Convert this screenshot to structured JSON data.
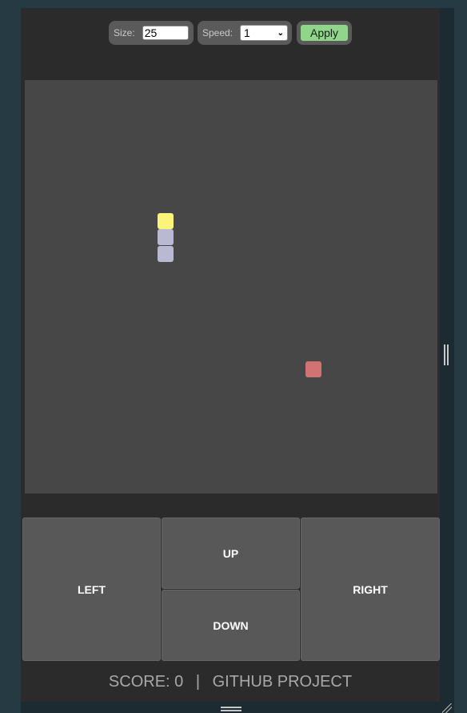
{
  "settings": {
    "size_label": "Size:",
    "size_value": "25",
    "speed_label": "Speed:",
    "speed_value": "1",
    "apply_label": "Apply",
    "apply_color": "#8fd68a"
  },
  "board": {
    "grid_size": 25,
    "background": "#474747",
    "snake": [
      {
        "col": 8,
        "row": 8,
        "part": "head"
      },
      {
        "col": 8,
        "row": 9,
        "part": "body"
      },
      {
        "col": 8,
        "row": 10,
        "part": "body"
      }
    ],
    "food": {
      "col": 17,
      "row": 17
    },
    "colors": {
      "head": "#faf57a",
      "body": "#b9b9d3",
      "food": "#d27373"
    }
  },
  "controls": {
    "left_label": "LEFT",
    "up_label": "UP",
    "down_label": "DOWN",
    "right_label": "RIGHT"
  },
  "footer": {
    "score_label": "SCORE:",
    "score_value": "0",
    "separator": "|",
    "link_label": "GITHUB PROJECT"
  }
}
